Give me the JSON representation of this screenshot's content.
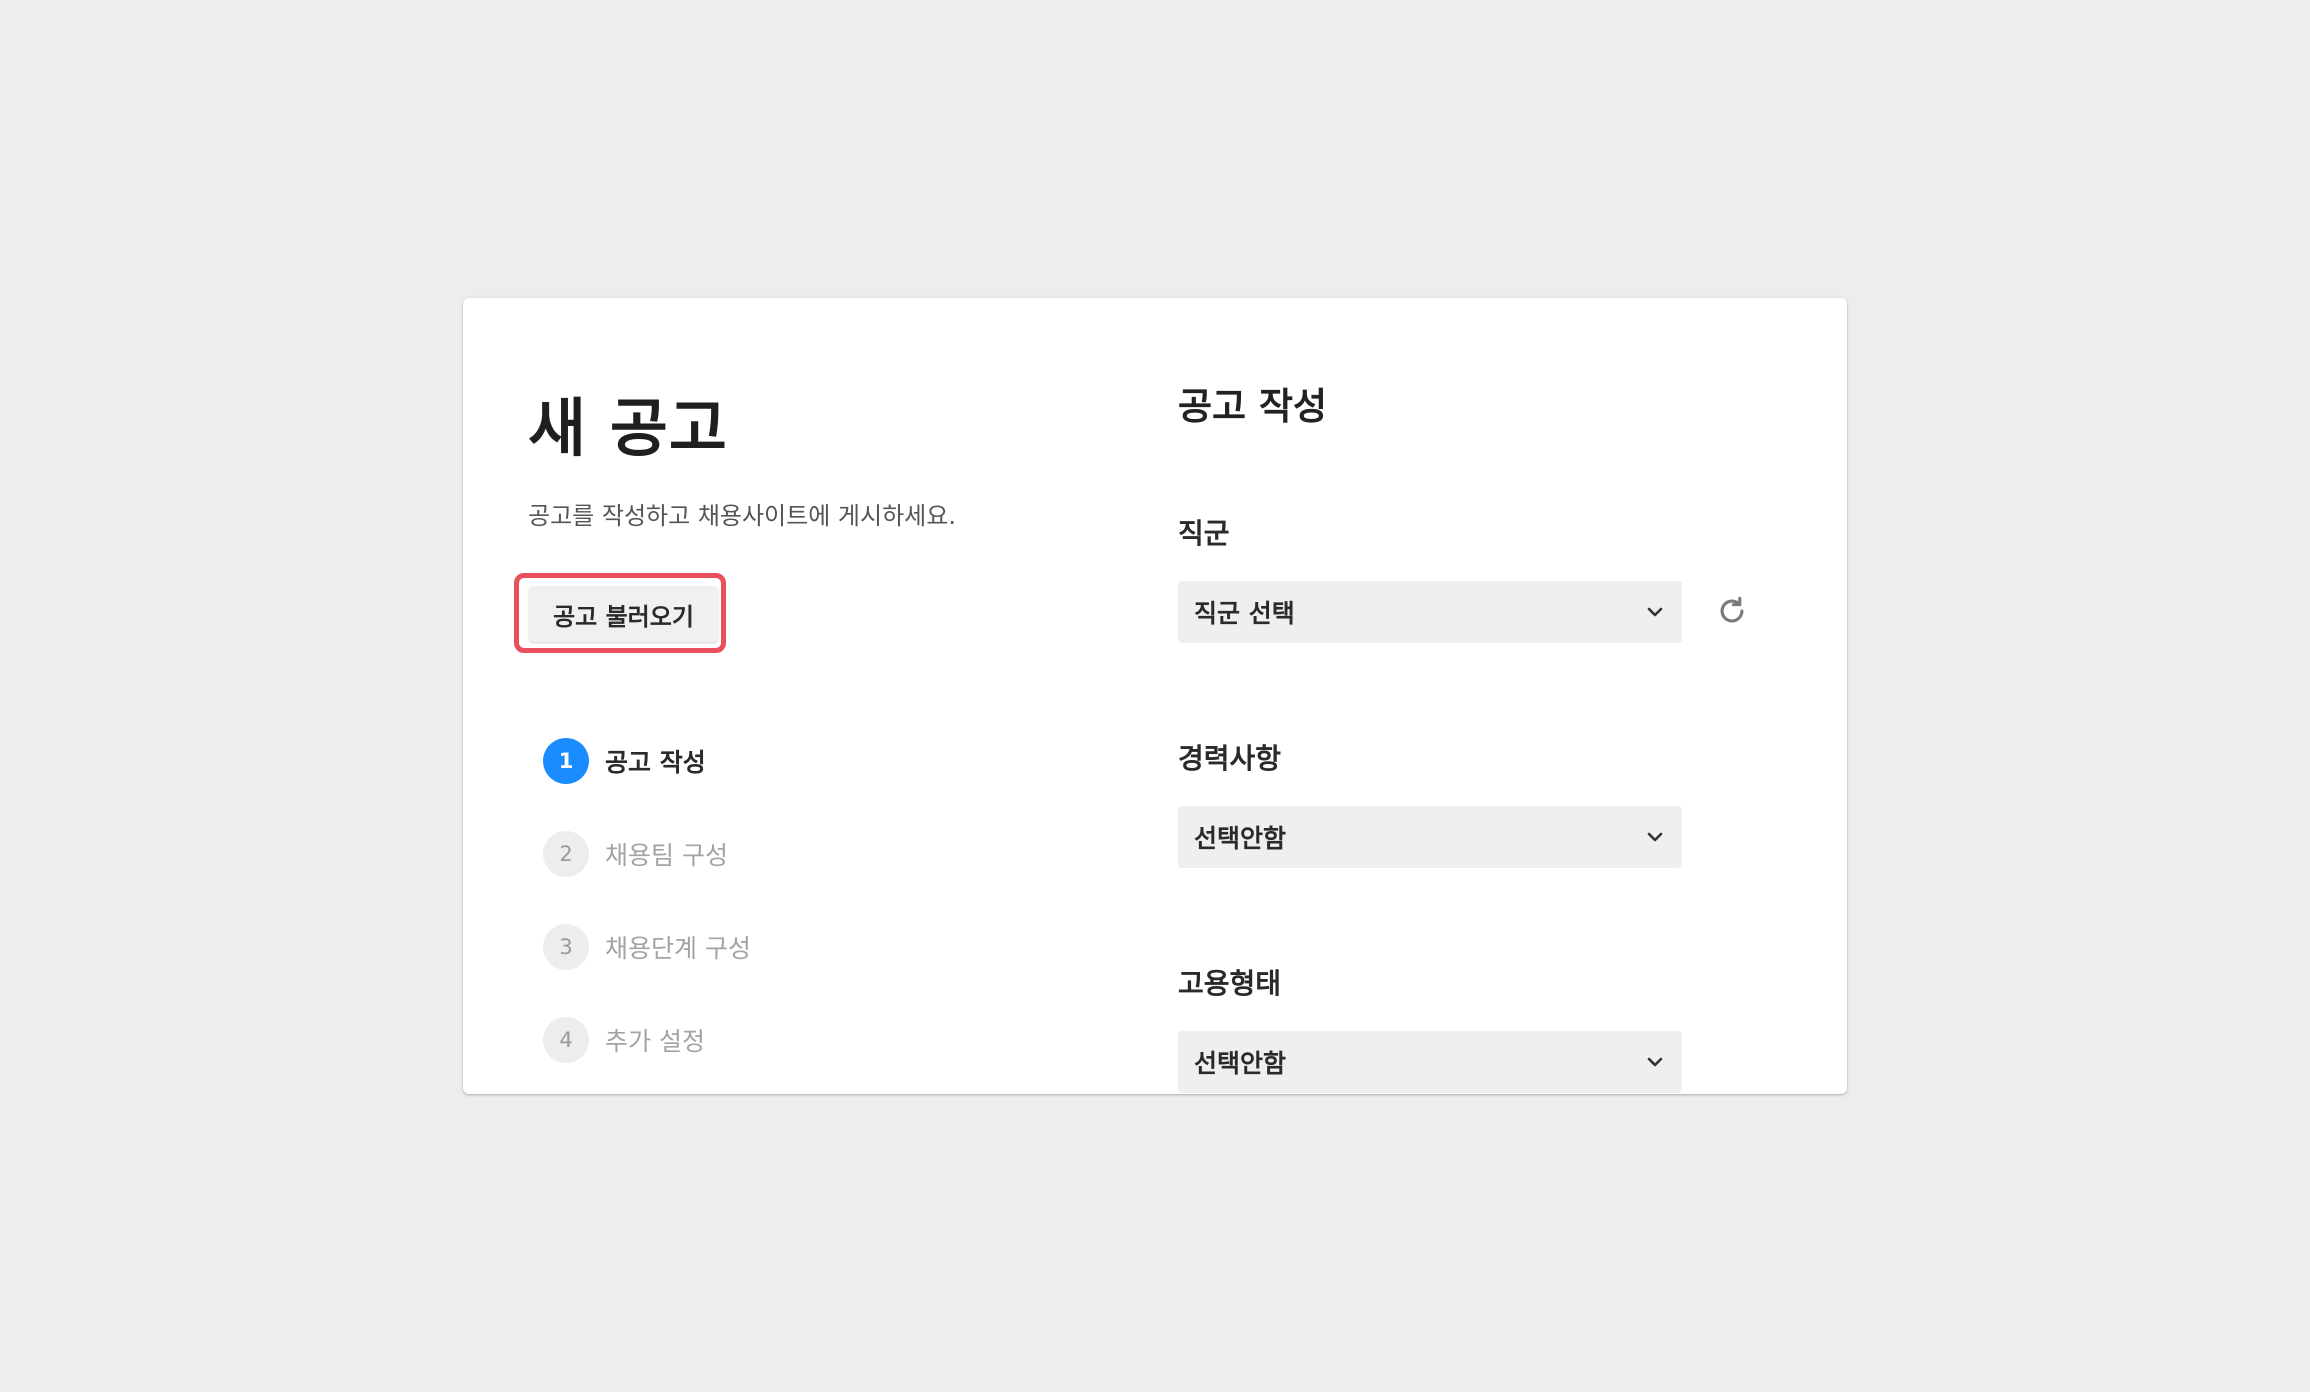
{
  "page": {
    "title": "새 공고",
    "subtitle": "공고를 작성하고 채용사이트에 게시하세요.",
    "load_button": "공고 불러오기"
  },
  "steps": [
    {
      "number": "1",
      "label": "공고 작성",
      "active": true
    },
    {
      "number": "2",
      "label": "채용팀 구성",
      "active": false
    },
    {
      "number": "3",
      "label": "채용단계 구성",
      "active": false
    },
    {
      "number": "4",
      "label": "추가 설정",
      "active": false
    }
  ],
  "form": {
    "section_title": "공고 작성",
    "job_group": {
      "label": "직군",
      "value": "직군 선택"
    },
    "experience": {
      "label": "경력사항",
      "value": "선택안함"
    },
    "employment_type": {
      "label": "고용형태",
      "value": "선택안함"
    }
  },
  "icons": {
    "dropdown": "chevron-down-icon",
    "refresh": "refresh-icon"
  },
  "colors": {
    "accent": "#1a8cff",
    "highlight": "#e8505b",
    "background": "#ededed",
    "field_bg": "#efefef"
  }
}
